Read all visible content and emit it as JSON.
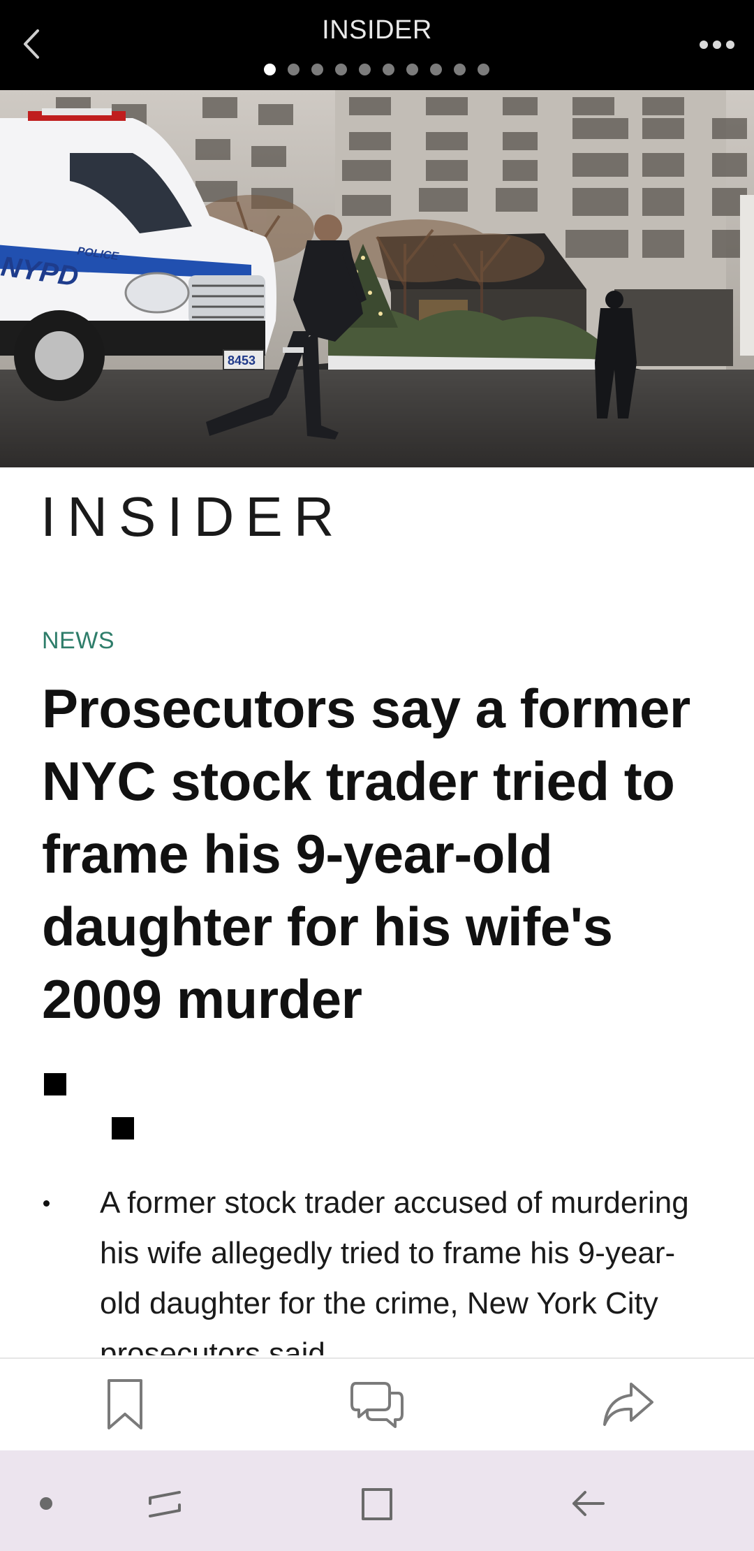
{
  "topbar": {
    "title": "INSIDER",
    "page_indicator": {
      "total": 10,
      "current": 1
    },
    "icons": {
      "back": "back-chevron-icon",
      "more": "more-dots-icon"
    }
  },
  "hero": {
    "description_icon": "photo",
    "van_texts": {
      "nypd": "NYPD",
      "police": "POLICE",
      "plate": "8453"
    }
  },
  "article": {
    "publisher_logo": "INSIDER",
    "category": "NEWS",
    "headline": "Prosecutors say a former NYC stock trader tried to frame his 9-year-old daughter for his wife's 2009 murder",
    "bullets": [
      "A former stock trader accused of murdering his wife allegedly tried to frame his 9-year-old daughter for the crime, New York City prosecutors said"
    ]
  },
  "action_bar": {
    "icons": [
      "bookmark-icon",
      "comments-icon",
      "share-icon"
    ]
  },
  "system_nav": {
    "icons": [
      "dot-icon",
      "recent-apps-icon",
      "home-icon",
      "back-arrow-icon"
    ]
  },
  "colors": {
    "topbar_bg": "#000000",
    "category": "#2e7d6a",
    "navbar_bg": "#ece4ee",
    "icon_gray": "#7a7a7a"
  }
}
